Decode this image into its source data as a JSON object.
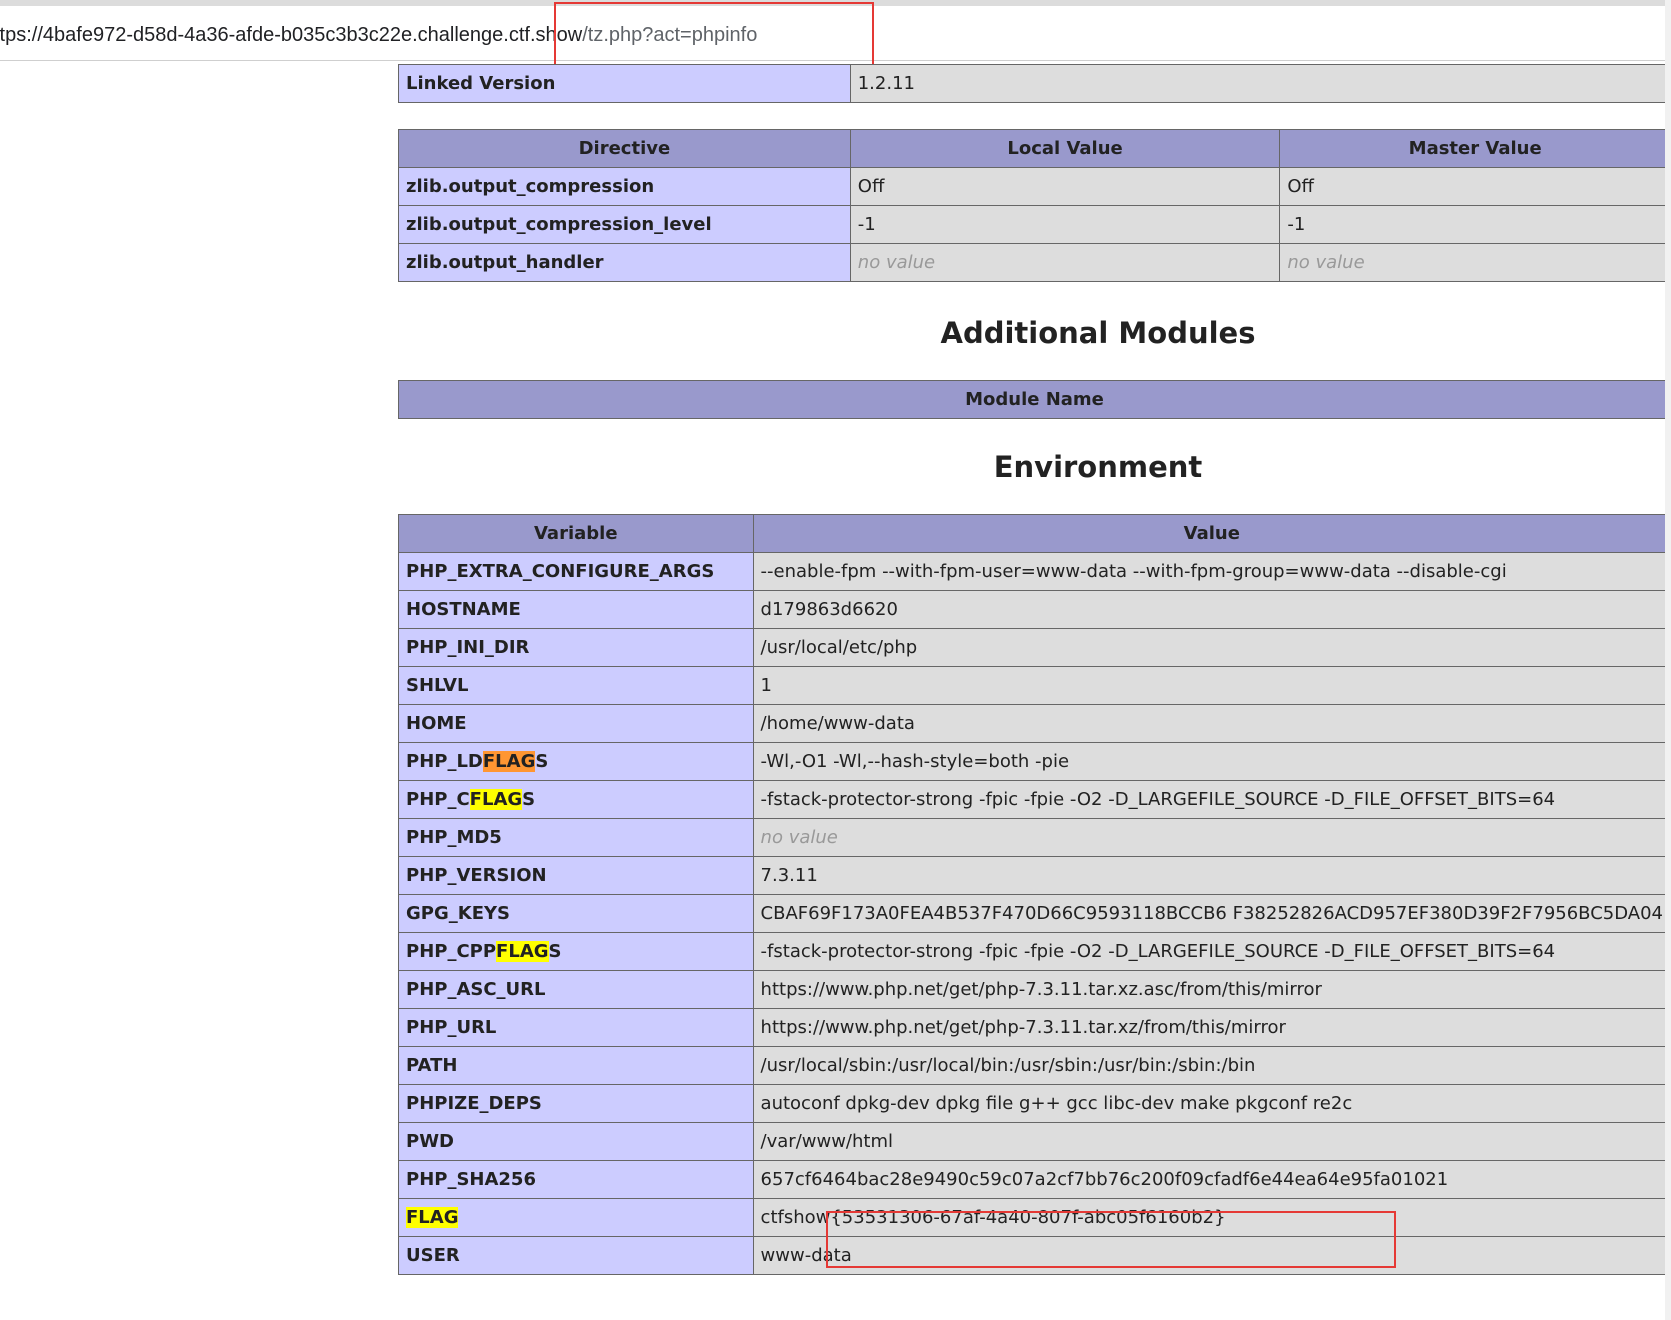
{
  "browser": {
    "url_host": "ttps://4bafe972-d58d-4a36-afde-b035c3b3c22e.challenge.ctf.show",
    "url_path": "/tz.php?act=phpinfo"
  },
  "linked": {
    "label": "Linked Version",
    "value": "1.2.11"
  },
  "zlib": {
    "headers": [
      "Directive",
      "Local Value",
      "Master Value"
    ],
    "rows": [
      {
        "name": "zlib.output_compression",
        "local": "Off",
        "master": "Off"
      },
      {
        "name": "zlib.output_compression_level",
        "local": "-1",
        "master": "-1"
      },
      {
        "name": "zlib.output_handler",
        "local": "no value",
        "master": "no value"
      }
    ]
  },
  "modules": {
    "title": "Additional Modules",
    "header": "Module Name"
  },
  "environment": {
    "title": "Environment",
    "headers": [
      "Variable",
      "Value"
    ],
    "rows": [
      {
        "name": "PHP_EXTRA_CONFIGURE_ARGS",
        "value": "--enable-fpm --with-fpm-user=www-data --with-fpm-group=www-data --disable-cgi"
      },
      {
        "name": "HOSTNAME",
        "value": "d179863d6620"
      },
      {
        "name": "PHP_INI_DIR",
        "value": "/usr/local/etc/php"
      },
      {
        "name": "SHLVL",
        "value": "1"
      },
      {
        "name": "HOME",
        "value": "/home/www-data"
      },
      {
        "name_pre": "PHP_LD",
        "name_hl": "FLAG",
        "name_post": "S",
        "value": "-Wl,-O1 -Wl,--hash-style=both -pie"
      },
      {
        "name_pre": "PHP_C",
        "name_hl": "FLAG",
        "name_post": "S",
        "value": "-fstack-protector-strong -fpic -fpie -O2 -D_LARGEFILE_SOURCE -D_FILE_OFFSET_BITS=64"
      },
      {
        "name": "PHP_MD5",
        "value": "no value"
      },
      {
        "name": "PHP_VERSION",
        "value": "7.3.11"
      },
      {
        "name": "GPG_KEYS",
        "value": "CBAF69F173A0FEA4B537F470D66C9593118BCCB6 F38252826ACD957EF380D39F2F7956BC5DA04"
      },
      {
        "name_pre": "PHP_CPP",
        "name_hl": "FLAG",
        "name_post": "S",
        "value": "-fstack-protector-strong -fpic -fpie -O2 -D_LARGEFILE_SOURCE -D_FILE_OFFSET_BITS=64"
      },
      {
        "name": "PHP_ASC_URL",
        "value": "https://www.php.net/get/php-7.3.11.tar.xz.asc/from/this/mirror"
      },
      {
        "name": "PHP_URL",
        "value": "https://www.php.net/get/php-7.3.11.tar.xz/from/this/mirror"
      },
      {
        "name": "PATH",
        "value": "/usr/local/sbin:/usr/local/bin:/usr/sbin:/usr/bin:/sbin:/bin"
      },
      {
        "name": "PHPIZE_DEPS",
        "value": "autoconf dpkg-dev dpkg file g++ gcc libc-dev make pkgconf re2c"
      },
      {
        "name": "PWD",
        "value": "/var/www/html"
      },
      {
        "name": "PHP_SHA256",
        "value": "657cf6464bac28e9490c59c07a2cf7bb76c200f09cfadf6e44ea64e95fa01021"
      },
      {
        "name_hl": "FLAG",
        "value": "ctfshow{53531306-67af-4a40-807f-abc05f6160b2}"
      },
      {
        "name": "USER",
        "value": "www-data"
      }
    ]
  },
  "colors": {
    "header_bg": "#9999cc",
    "name_cell_bg": "#ccccff",
    "value_cell_bg": "#dddddd",
    "highlight_yellow": "#ffff00",
    "highlight_orange": "#ff9632",
    "annotation_red": "#e53935"
  }
}
